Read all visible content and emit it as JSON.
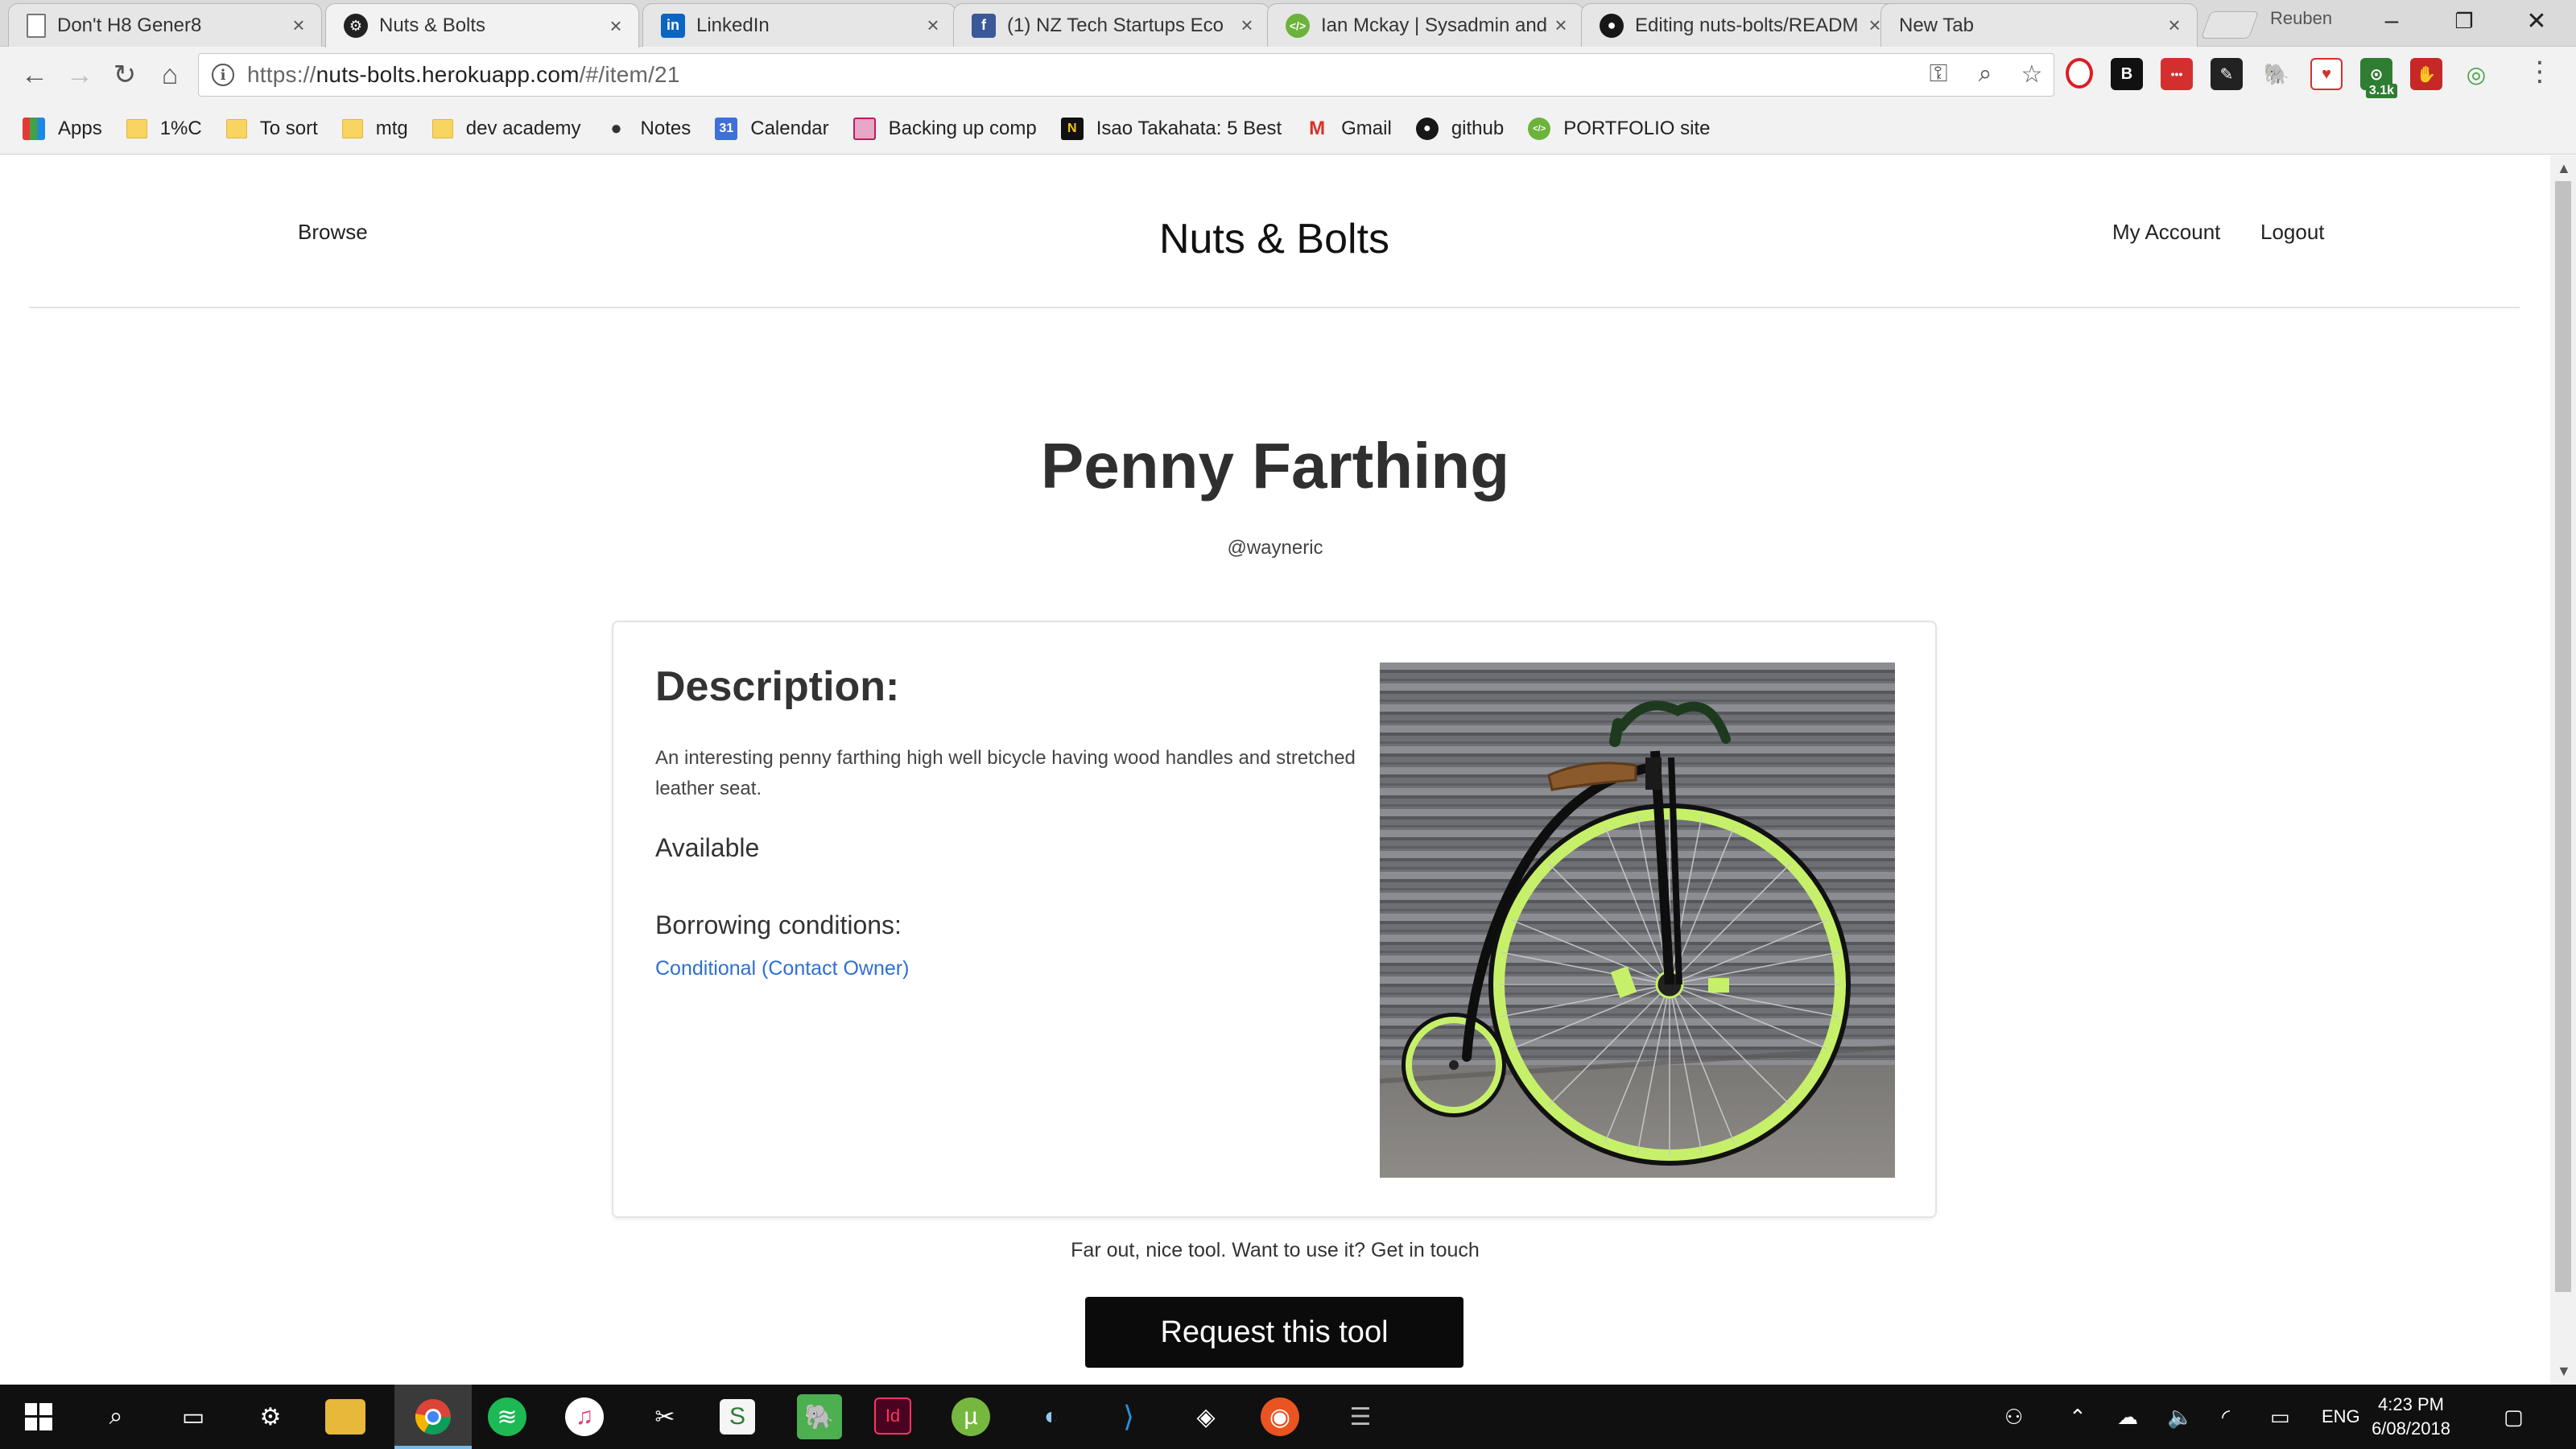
{
  "browser": {
    "tabs": [
      {
        "title": "Don't H8 Gener8",
        "favicon": "document-icon",
        "active": false
      },
      {
        "title": "Nuts & Bolts",
        "favicon": "nutsbolts-icon",
        "active": true
      },
      {
        "title": "LinkedIn",
        "favicon": "linkedin-icon",
        "active": false
      },
      {
        "title": "(1) NZ Tech Startups Eco",
        "favicon": "facebook-icon",
        "active": false
      },
      {
        "title": "Ian Mckay | Sysadmin and",
        "favicon": "code-icon",
        "active": false
      },
      {
        "title": "Editing nuts-bolts/READM",
        "favicon": "github-icon",
        "active": false
      },
      {
        "title": "New Tab",
        "favicon": "",
        "active": false
      }
    ],
    "tab_close_glyph": "×",
    "profile_name": "Reuben",
    "address": {
      "scheme": "https://",
      "host": "nuts-bolts.herokuapp.com",
      "path": "/#/item/21"
    },
    "extension_badge": "3.1k",
    "bookmarks": [
      {
        "label": "Apps",
        "icon": "apps-grid-icon"
      },
      {
        "label": "1%C",
        "icon": "folder-icon"
      },
      {
        "label": "To sort",
        "icon": "folder-icon"
      },
      {
        "label": "mtg",
        "icon": "folder-icon"
      },
      {
        "label": "dev academy",
        "icon": "folder-icon"
      },
      {
        "label": "Notes",
        "icon": "apple-icon"
      },
      {
        "label": "Calendar",
        "icon": "calendar-icon"
      },
      {
        "label": "Backing up comp",
        "icon": "bookmark-icon"
      },
      {
        "label": "Isao Takahata: 5 Best",
        "icon": "imdb-icon"
      },
      {
        "label": "Gmail",
        "icon": "gmail-icon"
      },
      {
        "label": "github",
        "icon": "github-icon"
      },
      {
        "label": "PORTFOLIO site",
        "icon": "code-icon"
      }
    ]
  },
  "site": {
    "nav": {
      "browse": "Browse",
      "brand": "Nuts & Bolts",
      "account": "My Account",
      "logout": "Logout"
    },
    "item": {
      "title": "Penny Farthing",
      "owner": "@wayneric",
      "description_heading": "Description:",
      "description": "An interesting penny farthing high well bicycle having wood handles and stretched leather seat.",
      "availability": "Available",
      "borrowing_heading": "Borrowing conditions:",
      "borrowing_condition": "Conditional (Contact Owner)",
      "image_subject": "penny farthing bicycle with lime green tyres against grey roller door"
    },
    "cta": {
      "text": "Far out, nice tool. Want to use it? Get in touch",
      "button": "Request this tool"
    }
  },
  "taskbar": {
    "language": "ENG",
    "time": "4:23 PM",
    "date": "6/08/2018"
  },
  "colors": {
    "link": "#2f6fd0",
    "button_bg": "#0b0b0b",
    "tyre_green": "#c6f06a"
  }
}
